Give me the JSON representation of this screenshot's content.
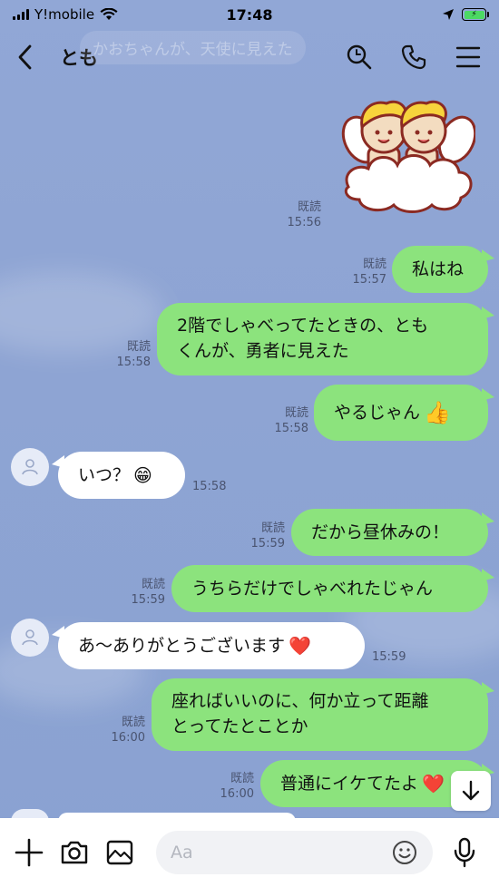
{
  "status_bar": {
    "carrier": "Y!mobile",
    "time": "17:48"
  },
  "header": {
    "title": "とも",
    "ghost_text": "かおちゃんが、天使に見えた"
  },
  "messages": [
    {
      "dir": "out",
      "read": "既読",
      "time": "15:56",
      "type": "sticker"
    },
    {
      "dir": "out",
      "read": "既読",
      "time": "15:57",
      "text": "私はね"
    },
    {
      "dir": "out",
      "read": "既読",
      "time": "15:58",
      "line1": "2階でしゃべってたときの、とも",
      "line2": "くんが、勇者に見えた"
    },
    {
      "dir": "out",
      "read": "既読",
      "time": "15:58",
      "text": "やるじゃん",
      "emoji": "👍"
    },
    {
      "dir": "in",
      "time": "15:58",
      "text": "いつ？",
      "emoji": "😁"
    },
    {
      "dir": "out",
      "read": "既読",
      "time": "15:59",
      "text": "だから昼休みの！"
    },
    {
      "dir": "out",
      "read": "既読",
      "time": "15:59",
      "text": "うちらだけでしゃべれたじゃん"
    },
    {
      "dir": "in",
      "time": "15:59",
      "text": "あ〜ありがとうございます",
      "emoji": "❤️"
    },
    {
      "dir": "out",
      "read": "既読",
      "time": "16:00",
      "line1": "座ればいいのに、何か立って距離",
      "line2": "とってたとことか"
    },
    {
      "dir": "out",
      "read": "既読",
      "time": "16:00",
      "text": "普通にイケてたよ",
      "emoji": "❤️"
    }
  ],
  "input": {
    "placeholder": "Aa"
  },
  "icons": [
    "back-icon",
    "search-icon",
    "phone-icon",
    "menu-icon",
    "plus-icon",
    "camera-icon",
    "image-icon",
    "emoji-icon",
    "mic-icon",
    "arrow-down-icon",
    "wifi-icon",
    "location-icon",
    "battery-icon"
  ],
  "colors": {
    "background": "#8da4d4",
    "outgoing_bubble": "#8ce37d",
    "incoming_bubble": "#ffffff",
    "meta_text": "#4a5470"
  }
}
